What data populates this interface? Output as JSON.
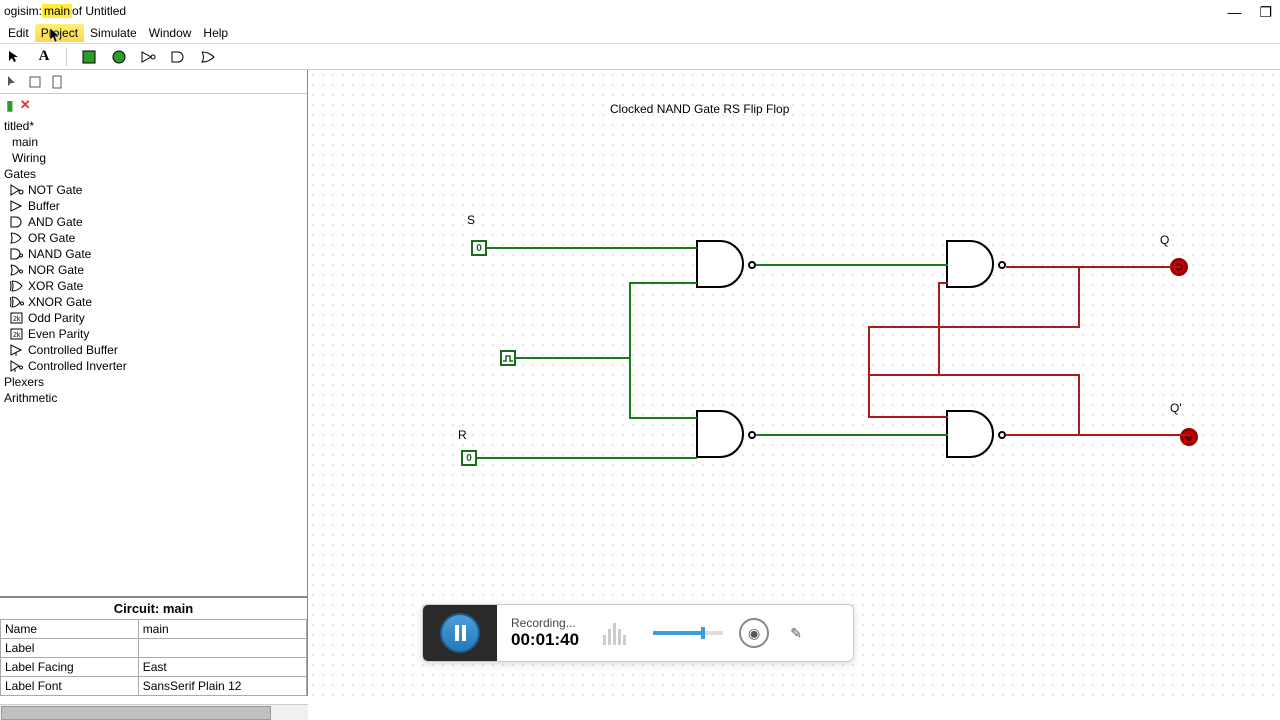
{
  "window": {
    "title_prefix": "ogisim: ",
    "title_highlight": "main",
    "title_suffix": " of Untitled"
  },
  "menus": {
    "edit": "Edit",
    "project": "Project",
    "simulate": "Simulate",
    "window": "Window",
    "help": "Help"
  },
  "tree": {
    "root": "titled*",
    "main": "main",
    "wiring": "Wiring",
    "gates_folder": "Gates",
    "gates": [
      "NOT Gate",
      "Buffer",
      "AND Gate",
      "OR Gate",
      "NAND Gate",
      "NOR Gate",
      "XOR Gate",
      "XNOR Gate",
      "Odd Parity",
      "Even Parity",
      "Controlled Buffer",
      "Controlled Inverter"
    ],
    "plexers": "Plexers",
    "arithmetic": "Arithmetic"
  },
  "props": {
    "header": "Circuit: main",
    "rows": [
      {
        "k": "Name",
        "v": "main"
      },
      {
        "k": "Label",
        "v": ""
      },
      {
        "k": "Label Facing",
        "v": "East"
      },
      {
        "k": "Label Font",
        "v": "SansSerif Plain 12"
      }
    ]
  },
  "canvas": {
    "title": "Clocked NAND Gate RS Flip Flop",
    "label_s": "S",
    "label_r": "R",
    "label_q": "Q",
    "label_qn": "Q'",
    "pin_s_val": "0",
    "pin_r_val": "0"
  },
  "recorder": {
    "status": "Recording...",
    "time": "00:01:40"
  }
}
